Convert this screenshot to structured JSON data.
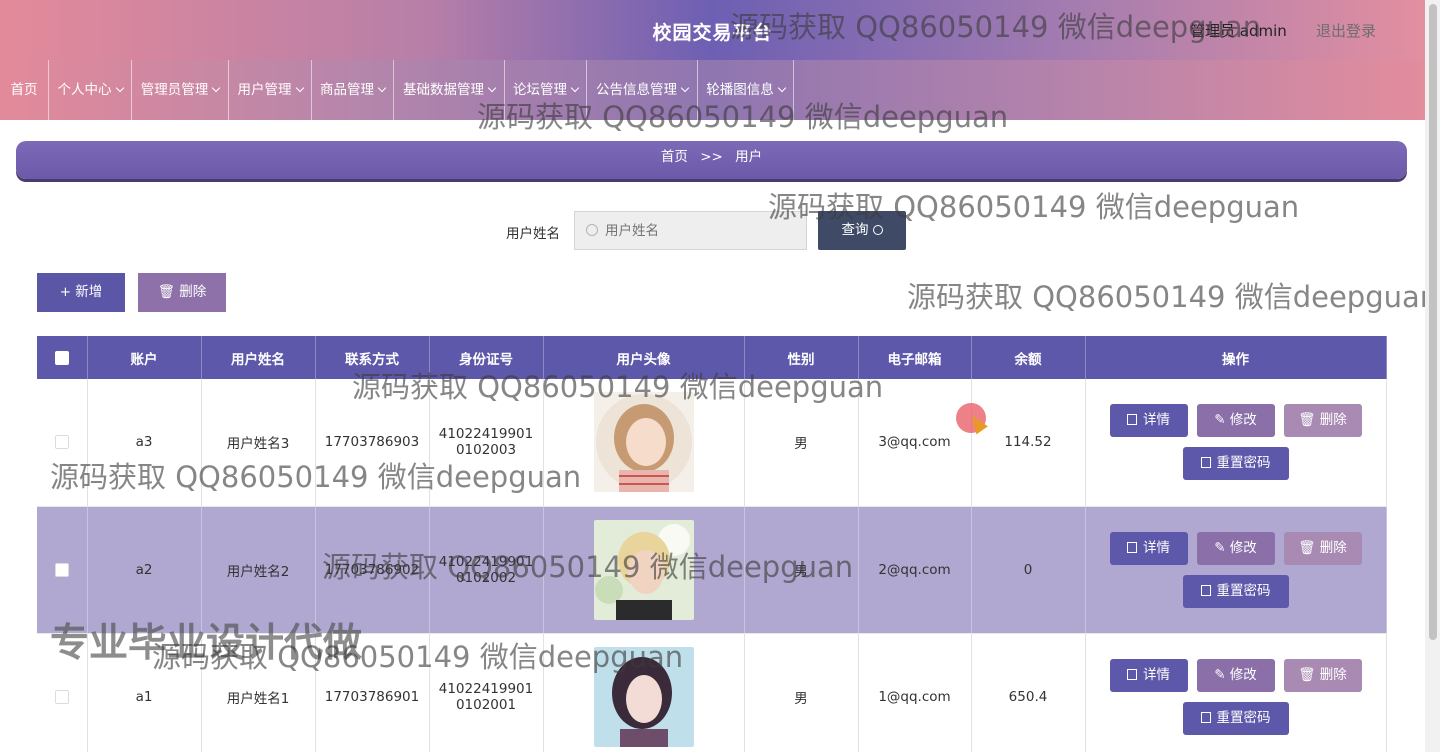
{
  "header": {
    "title": "校园交易平台",
    "user": "管理员 admin",
    "logout": "退出登录"
  },
  "nav": [
    {
      "label": "首页"
    },
    {
      "label": "个人中心"
    },
    {
      "label": "管理员管理"
    },
    {
      "label": "用户管理"
    },
    {
      "label": "商品管理"
    },
    {
      "label": "基础数据管理"
    },
    {
      "label": "论坛管理"
    },
    {
      "label": "公告信息管理"
    },
    {
      "label": "轮播图信息"
    }
  ],
  "breadcrumb": {
    "home": "首页",
    "sep": ">>",
    "current": "用户"
  },
  "search": {
    "label": "用户姓名",
    "placeholder": "用户姓名",
    "button": "查询"
  },
  "actions": {
    "add": "新增",
    "delete": "删除"
  },
  "table": {
    "headers": [
      "账户",
      "用户姓名",
      "联系方式",
      "身份证号",
      "用户头像",
      "性别",
      "电子邮箱",
      "余额",
      "操作"
    ],
    "rows": [
      {
        "account": "a3",
        "name": "用户姓名3",
        "phone": "17703786903",
        "id_line1": "41022419901",
        "id_line2": "0102003",
        "gender": "男",
        "email": "3@qq.com",
        "balance": "114.52"
      },
      {
        "account": "a2",
        "name": "用户姓名2",
        "phone": "17703786902",
        "id_line1": "41022419901",
        "id_line2": "0102002",
        "gender": "男",
        "email": "2@qq.com",
        "balance": "0"
      },
      {
        "account": "a1",
        "name": "用户姓名1",
        "phone": "17703786901",
        "id_line1": "41022419901",
        "id_line2": "0102001",
        "gender": "男",
        "email": "1@qq.com",
        "balance": "650.4"
      }
    ],
    "ops": {
      "detail": "详情",
      "edit": "修改",
      "delete": "删除",
      "reset": "重置密码"
    }
  },
  "watermarks": {
    "text": "源码获取 QQ86050149 微信deepguan",
    "banner": "专业毕业设计代做"
  },
  "colors": {
    "primary": "#5d58a9",
    "header_gradient_mid": "#6d5fb3",
    "row_alt": "#b1a8d1"
  }
}
